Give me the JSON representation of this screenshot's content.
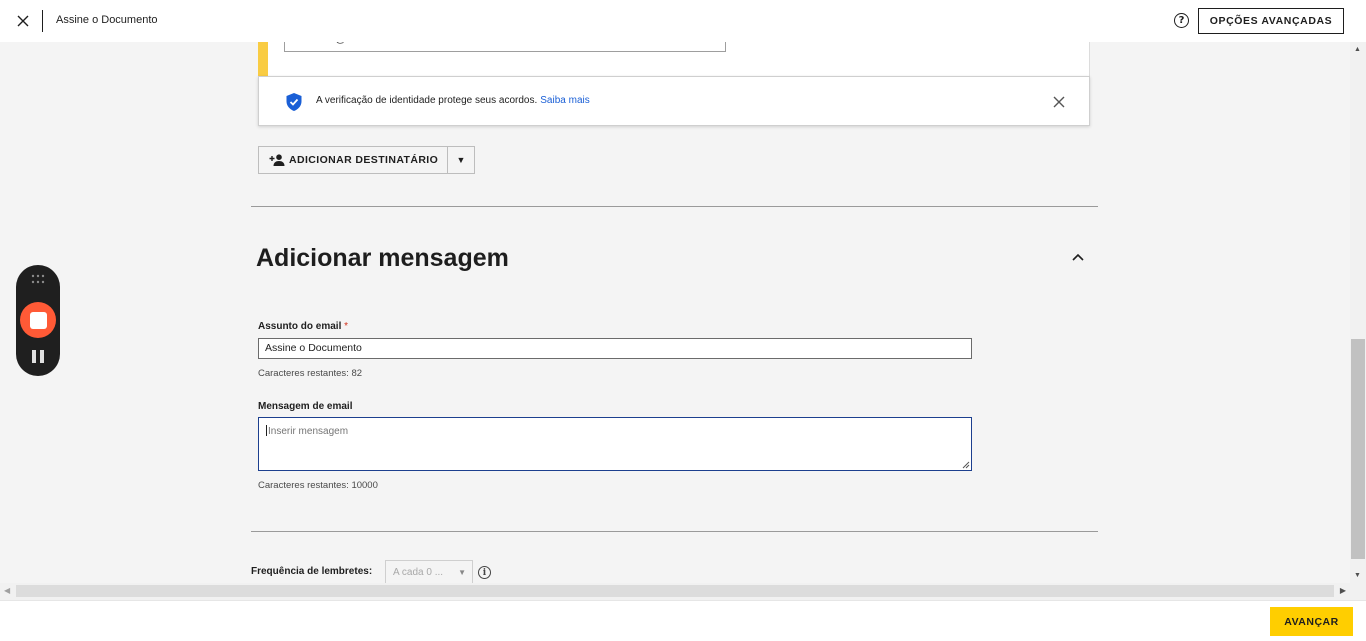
{
  "header": {
    "document_title": "Assine o Documento",
    "advanced_options_label": "OPÇÕES AVANÇADAS",
    "help_glyph": "?"
  },
  "recipient": {
    "email_value": "inovacao@wtavet.com.br",
    "accent_color": "#f9cc43"
  },
  "identity_banner": {
    "text": "A verificação de identidade protege seus acordos.",
    "link_label": "Saiba mais",
    "shield_color": "#1a5fd6"
  },
  "add_recipient": {
    "label": "ADICIONAR DESTINATÁRIO",
    "dropdown_glyph": "▼"
  },
  "message_section": {
    "title": "Adicionar mensagem",
    "subject_label": "Assunto do email",
    "required_mark": "*",
    "subject_value": "Assine o Documento",
    "subject_remaining": "Caracteres restantes: 82",
    "message_label": "Mensagem de email",
    "message_placeholder": "Inserir mensagem",
    "message_remaining": "Caracteres restantes: 10000"
  },
  "reminders": {
    "label": "Frequência de lembretes:",
    "select_value": "A cada 0 ...",
    "info_glyph": "i"
  },
  "footer": {
    "next_label": "AVANÇAR",
    "next_color": "#ffce00"
  },
  "recorder": {
    "record_color": "#ff5a36"
  }
}
